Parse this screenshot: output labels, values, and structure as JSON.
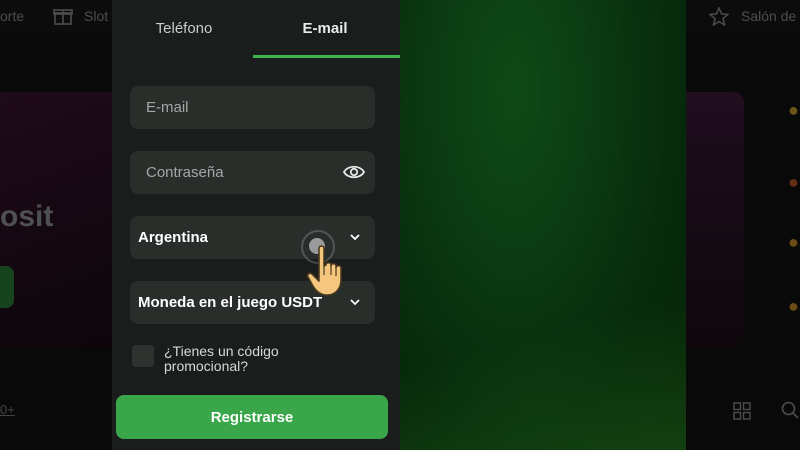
{
  "background": {
    "nav_left": "orte",
    "nav_slots": "Slot",
    "nav_right": "Salón de",
    "deposit_text": "osit",
    "link_text": "0+"
  },
  "tabs": [
    {
      "label": "Teléfono",
      "active": false
    },
    {
      "label": "E-mail",
      "active": true
    }
  ],
  "form": {
    "email_placeholder": "E-mail",
    "password_placeholder": "Contraseña",
    "country_value": "Argentina",
    "currency_value": "Moneda en el juego USDT",
    "promo_label": "¿Tienes un código promocional?",
    "register_label": "Registrarse"
  },
  "icons": {
    "eye": "eye-icon",
    "chevron": "chevron-down-icon",
    "hand": "hand-pointer-icon",
    "star": "star-icon",
    "gift": "gift-icon",
    "grid": "grid-icon",
    "search": "search-icon"
  },
  "colors": {
    "accent": "#3fb34f",
    "button": "#3aa64a",
    "panel": "#1a1d1b",
    "field": "#2a2e2b"
  }
}
